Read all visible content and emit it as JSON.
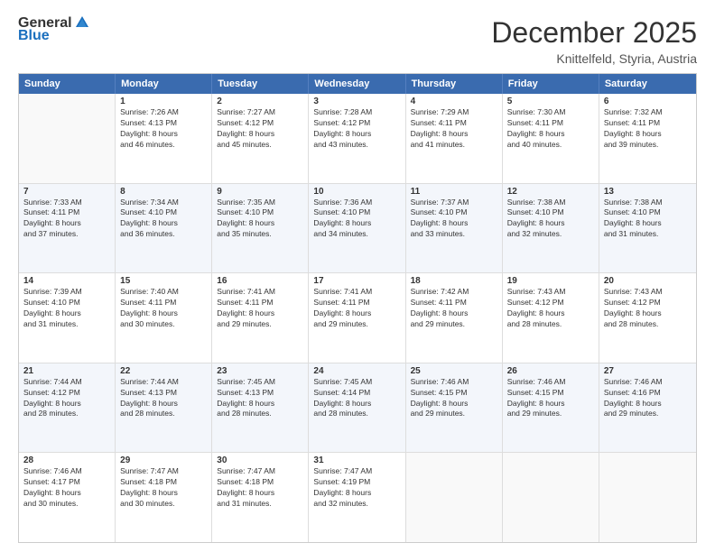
{
  "logo": {
    "general": "General",
    "blue": "Blue"
  },
  "title": "December 2025",
  "location": "Knittelfeld, Styria, Austria",
  "days": [
    "Sunday",
    "Monday",
    "Tuesday",
    "Wednesday",
    "Thursday",
    "Friday",
    "Saturday"
  ],
  "weeks": [
    [
      {
        "day": "",
        "lines": [],
        "empty": true
      },
      {
        "day": "1",
        "lines": [
          "Sunrise: 7:26 AM",
          "Sunset: 4:13 PM",
          "Daylight: 8 hours",
          "and 46 minutes."
        ]
      },
      {
        "day": "2",
        "lines": [
          "Sunrise: 7:27 AM",
          "Sunset: 4:12 PM",
          "Daylight: 8 hours",
          "and 45 minutes."
        ]
      },
      {
        "day": "3",
        "lines": [
          "Sunrise: 7:28 AM",
          "Sunset: 4:12 PM",
          "Daylight: 8 hours",
          "and 43 minutes."
        ]
      },
      {
        "day": "4",
        "lines": [
          "Sunrise: 7:29 AM",
          "Sunset: 4:11 PM",
          "Daylight: 8 hours",
          "and 41 minutes."
        ]
      },
      {
        "day": "5",
        "lines": [
          "Sunrise: 7:30 AM",
          "Sunset: 4:11 PM",
          "Daylight: 8 hours",
          "and 40 minutes."
        ]
      },
      {
        "day": "6",
        "lines": [
          "Sunrise: 7:32 AM",
          "Sunset: 4:11 PM",
          "Daylight: 8 hours",
          "and 39 minutes."
        ]
      }
    ],
    [
      {
        "day": "7",
        "lines": [
          "Sunrise: 7:33 AM",
          "Sunset: 4:11 PM",
          "Daylight: 8 hours",
          "and 37 minutes."
        ]
      },
      {
        "day": "8",
        "lines": [
          "Sunrise: 7:34 AM",
          "Sunset: 4:10 PM",
          "Daylight: 8 hours",
          "and 36 minutes."
        ]
      },
      {
        "day": "9",
        "lines": [
          "Sunrise: 7:35 AM",
          "Sunset: 4:10 PM",
          "Daylight: 8 hours",
          "and 35 minutes."
        ]
      },
      {
        "day": "10",
        "lines": [
          "Sunrise: 7:36 AM",
          "Sunset: 4:10 PM",
          "Daylight: 8 hours",
          "and 34 minutes."
        ]
      },
      {
        "day": "11",
        "lines": [
          "Sunrise: 7:37 AM",
          "Sunset: 4:10 PM",
          "Daylight: 8 hours",
          "and 33 minutes."
        ]
      },
      {
        "day": "12",
        "lines": [
          "Sunrise: 7:38 AM",
          "Sunset: 4:10 PM",
          "Daylight: 8 hours",
          "and 32 minutes."
        ]
      },
      {
        "day": "13",
        "lines": [
          "Sunrise: 7:38 AM",
          "Sunset: 4:10 PM",
          "Daylight: 8 hours",
          "and 31 minutes."
        ]
      }
    ],
    [
      {
        "day": "14",
        "lines": [
          "Sunrise: 7:39 AM",
          "Sunset: 4:10 PM",
          "Daylight: 8 hours",
          "and 31 minutes."
        ]
      },
      {
        "day": "15",
        "lines": [
          "Sunrise: 7:40 AM",
          "Sunset: 4:11 PM",
          "Daylight: 8 hours",
          "and 30 minutes."
        ]
      },
      {
        "day": "16",
        "lines": [
          "Sunrise: 7:41 AM",
          "Sunset: 4:11 PM",
          "Daylight: 8 hours",
          "and 29 minutes."
        ]
      },
      {
        "day": "17",
        "lines": [
          "Sunrise: 7:41 AM",
          "Sunset: 4:11 PM",
          "Daylight: 8 hours",
          "and 29 minutes."
        ]
      },
      {
        "day": "18",
        "lines": [
          "Sunrise: 7:42 AM",
          "Sunset: 4:11 PM",
          "Daylight: 8 hours",
          "and 29 minutes."
        ]
      },
      {
        "day": "19",
        "lines": [
          "Sunrise: 7:43 AM",
          "Sunset: 4:12 PM",
          "Daylight: 8 hours",
          "and 28 minutes."
        ]
      },
      {
        "day": "20",
        "lines": [
          "Sunrise: 7:43 AM",
          "Sunset: 4:12 PM",
          "Daylight: 8 hours",
          "and 28 minutes."
        ]
      }
    ],
    [
      {
        "day": "21",
        "lines": [
          "Sunrise: 7:44 AM",
          "Sunset: 4:12 PM",
          "Daylight: 8 hours",
          "and 28 minutes."
        ]
      },
      {
        "day": "22",
        "lines": [
          "Sunrise: 7:44 AM",
          "Sunset: 4:13 PM",
          "Daylight: 8 hours",
          "and 28 minutes."
        ]
      },
      {
        "day": "23",
        "lines": [
          "Sunrise: 7:45 AM",
          "Sunset: 4:13 PM",
          "Daylight: 8 hours",
          "and 28 minutes."
        ]
      },
      {
        "day": "24",
        "lines": [
          "Sunrise: 7:45 AM",
          "Sunset: 4:14 PM",
          "Daylight: 8 hours",
          "and 28 minutes."
        ]
      },
      {
        "day": "25",
        "lines": [
          "Sunrise: 7:46 AM",
          "Sunset: 4:15 PM",
          "Daylight: 8 hours",
          "and 29 minutes."
        ]
      },
      {
        "day": "26",
        "lines": [
          "Sunrise: 7:46 AM",
          "Sunset: 4:15 PM",
          "Daylight: 8 hours",
          "and 29 minutes."
        ]
      },
      {
        "day": "27",
        "lines": [
          "Sunrise: 7:46 AM",
          "Sunset: 4:16 PM",
          "Daylight: 8 hours",
          "and 29 minutes."
        ]
      }
    ],
    [
      {
        "day": "28",
        "lines": [
          "Sunrise: 7:46 AM",
          "Sunset: 4:17 PM",
          "Daylight: 8 hours",
          "and 30 minutes."
        ]
      },
      {
        "day": "29",
        "lines": [
          "Sunrise: 7:47 AM",
          "Sunset: 4:18 PM",
          "Daylight: 8 hours",
          "and 30 minutes."
        ]
      },
      {
        "day": "30",
        "lines": [
          "Sunrise: 7:47 AM",
          "Sunset: 4:18 PM",
          "Daylight: 8 hours",
          "and 31 minutes."
        ]
      },
      {
        "day": "31",
        "lines": [
          "Sunrise: 7:47 AM",
          "Sunset: 4:19 PM",
          "Daylight: 8 hours",
          "and 32 minutes."
        ]
      },
      {
        "day": "",
        "lines": [],
        "empty": true
      },
      {
        "day": "",
        "lines": [],
        "empty": true
      },
      {
        "day": "",
        "lines": [],
        "empty": true
      }
    ]
  ]
}
